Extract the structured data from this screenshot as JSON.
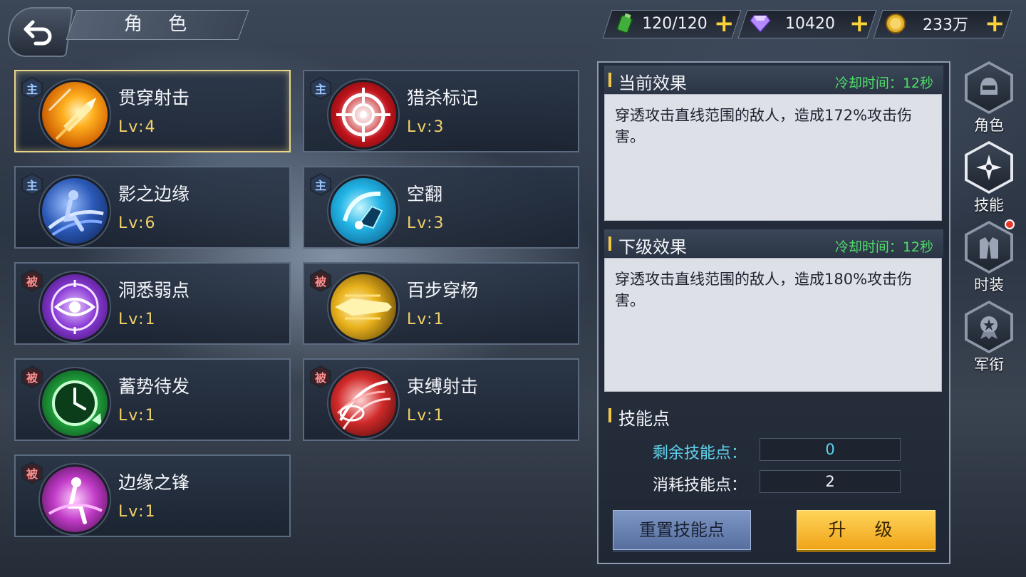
{
  "header": {
    "title": "角 色",
    "back_icon": "back-arrow-icon"
  },
  "resources": [
    {
      "icon": "energy-battery-icon",
      "value": "120/120"
    },
    {
      "icon": "diamond-icon",
      "value": "10420"
    },
    {
      "icon": "gold-coin-icon",
      "value": "233万"
    }
  ],
  "skills": [
    {
      "tag": "主",
      "type": "main",
      "name": "贯穿射击",
      "level": "Lv:4",
      "icon": "bullet-icon",
      "selected": true
    },
    {
      "tag": "主",
      "type": "main",
      "name": "猎杀标记",
      "level": "Lv:3",
      "icon": "crosshair-icon"
    },
    {
      "tag": "主",
      "type": "main",
      "name": "影之边缘",
      "level": "Lv:6",
      "icon": "shadow-dash-icon"
    },
    {
      "tag": "主",
      "type": "main",
      "name": "空翻",
      "level": "Lv:3",
      "icon": "flip-kick-icon"
    },
    {
      "tag": "被",
      "type": "passive",
      "name": "洞悉弱点",
      "level": "Lv:1",
      "icon": "eye-scope-icon"
    },
    {
      "tag": "被",
      "type": "passive",
      "name": "百步穿杨",
      "level": "Lv:1",
      "icon": "golden-arrow-icon"
    },
    {
      "tag": "被",
      "type": "passive",
      "name": "蓄势待发",
      "level": "Lv:1",
      "icon": "clock-icon"
    },
    {
      "tag": "被",
      "type": "passive",
      "name": "束缚射击",
      "level": "Lv:1",
      "icon": "binding-shot-icon"
    },
    {
      "tag": "被",
      "type": "passive",
      "name": "边缘之锋",
      "level": "Lv:1",
      "icon": "edge-blade-icon"
    }
  ],
  "current_effect": {
    "heading": "当前效果",
    "cooldown": "冷却时间：12秒",
    "text": "穿透攻击直线范围的敌人，造成172%攻击伤害。"
  },
  "next_effect": {
    "heading": "下级效果",
    "cooldown": "冷却时间：12秒",
    "text": "穿透攻击直线范围的敌人，造成180%攻击伤害。"
  },
  "skill_points": {
    "heading": "技能点",
    "remaining_label": "剩余技能点：",
    "remaining_value": "0",
    "cost_label": "消耗技能点：",
    "cost_value": "2"
  },
  "buttons": {
    "reset": "重置技能点",
    "upgrade": "升 级"
  },
  "side_nav": [
    {
      "label": "角色",
      "icon": "helmet-icon"
    },
    {
      "label": "技能",
      "icon": "shuriken-icon",
      "active": true
    },
    {
      "label": "时装",
      "icon": "suit-icon",
      "badge": true
    },
    {
      "label": "军衔",
      "icon": "medal-icon"
    }
  ],
  "colors": {
    "cooldown_green": "#4fdc6a",
    "level_yellow": "#f3d36a",
    "remaining_cyan": "#5fd3ee",
    "upgrade_orange": "#f5b52a",
    "selected_border": "#e8d48a"
  }
}
